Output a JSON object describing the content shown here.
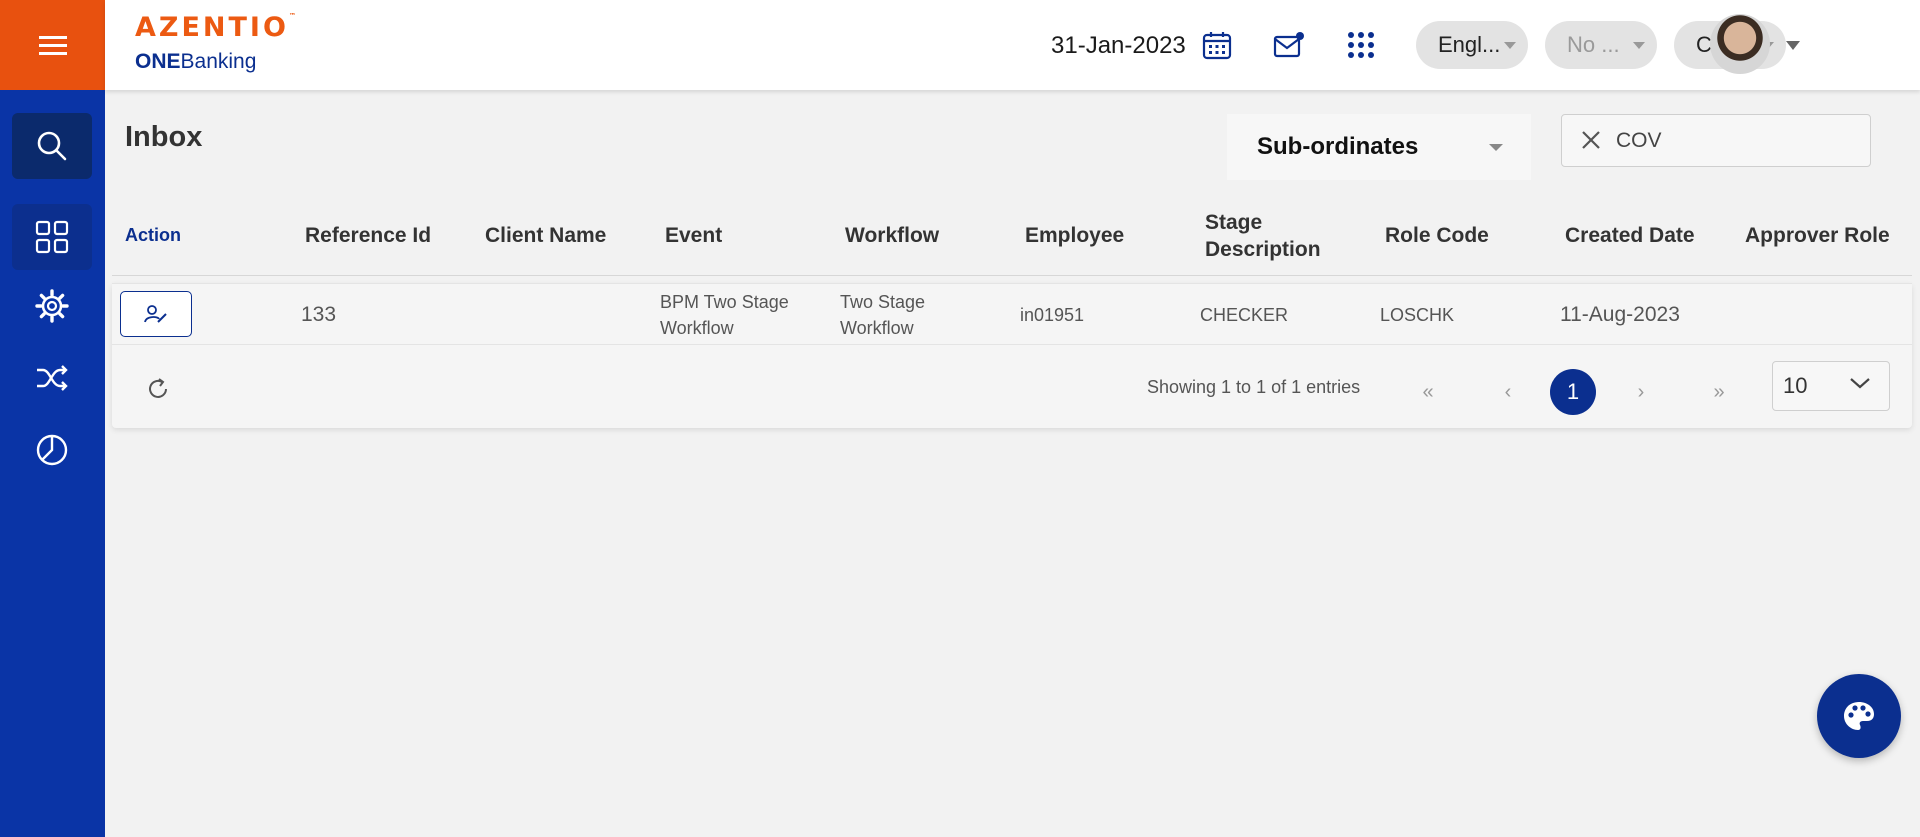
{
  "brand": {
    "name": "AZENTIO",
    "tm": "™",
    "product_bold": "ONE",
    "product_rest": "Banking"
  },
  "header": {
    "date": "31-Jan-2023",
    "language": "Engl...",
    "entity": "No ...",
    "branch": "Cen..."
  },
  "sidebar": {
    "items": [
      {
        "icon": "search-icon"
      },
      {
        "icon": "dashboard-grid-icon"
      },
      {
        "icon": "gear-icon"
      },
      {
        "icon": "shuffle-icon"
      },
      {
        "icon": "pie-chart-icon"
      }
    ]
  },
  "page": {
    "title": "Inbox",
    "filter_selected": "Sub-ordinates",
    "search_value": "COV"
  },
  "table": {
    "columns": [
      "Action",
      "Reference Id",
      "Client Name",
      "Event",
      "Workflow",
      "Employee",
      "Stage Description",
      "Role Code",
      "Created Date",
      "Approver Role"
    ],
    "rows": [
      {
        "reference_id": "133",
        "client_name": "",
        "event": "BPM Two Stage Workflow",
        "workflow": "Two Stage Workflow",
        "employee": "in01951",
        "stage_description": "CHECKER",
        "role_code": "LOSCHK",
        "created_date": "11-Aug-2023",
        "approver_role": ""
      }
    ]
  },
  "pager": {
    "summary": "Showing 1 to 1 of 1 entries",
    "first": "«",
    "prev": "‹",
    "current_page": "1",
    "next": "›",
    "last": "»",
    "page_size": "10"
  },
  "colors": {
    "accent_orange": "#e8510f",
    "brand_blue": "#0a34a6",
    "navy": "#0b2f8f"
  }
}
